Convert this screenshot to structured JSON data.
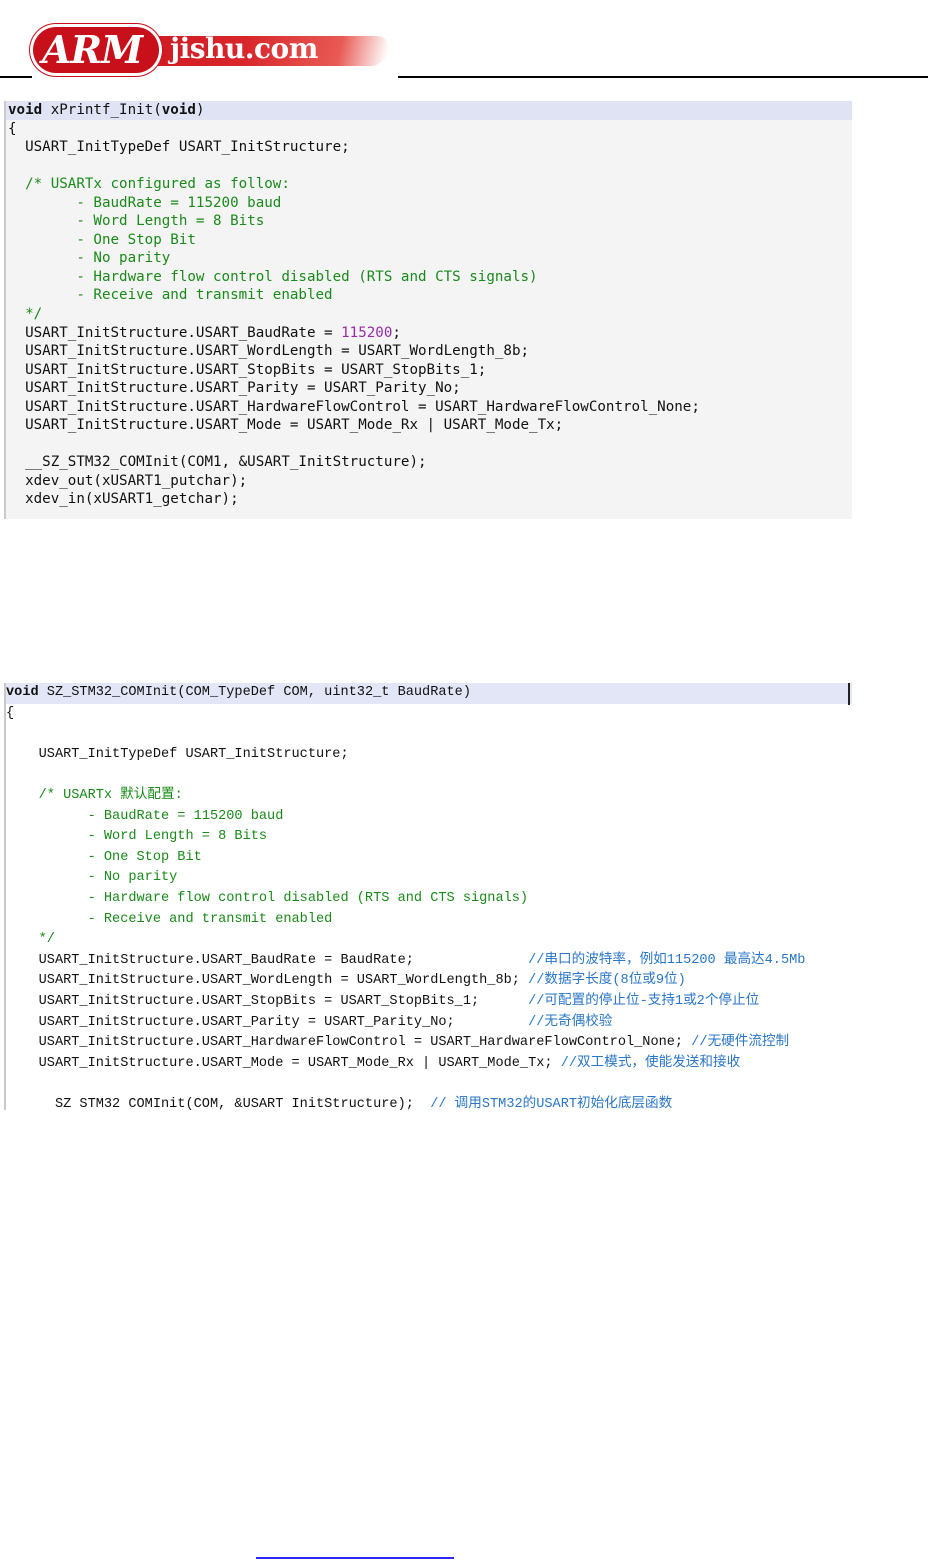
{
  "header": {
    "logo_brand": "ARM",
    "logo_site": "jishu.com"
  },
  "colors": {
    "code_keyword": "#111111",
    "code_comment": "#1a8a1a",
    "code_number": "#9a2aa8",
    "code_chinese_comment": "#2a76c8",
    "panel1_background": "#f4f4f4",
    "panel1_header_highlight": "#dfe3f3",
    "panel2_header_highlight": "#e3e6f6",
    "logo_red": "#c8101a"
  },
  "code_block_1": {
    "lines": [
      [
        {
          "t": "void",
          "c": "kw"
        },
        {
          "t": " xPrintf_Init("
        },
        {
          "t": "void",
          "c": "kw"
        },
        {
          "t": ")"
        }
      ],
      [
        {
          "t": "{"
        }
      ],
      [
        {
          "t": "  USART_InitTypeDef USART_InitStructure;"
        }
      ],
      [
        {
          "t": ""
        }
      ],
      [
        {
          "t": "  /* USARTx configured as follow:",
          "c": "cm"
        }
      ],
      [
        {
          "t": "        - BaudRate = 115200 baud",
          "c": "cm"
        }
      ],
      [
        {
          "t": "        - Word Length = 8 Bits",
          "c": "cm"
        }
      ],
      [
        {
          "t": "        - One Stop Bit",
          "c": "cm"
        }
      ],
      [
        {
          "t": "        - No parity",
          "c": "cm"
        }
      ],
      [
        {
          "t": "        - Hardware flow control disabled (RTS and CTS signals)",
          "c": "cm"
        }
      ],
      [
        {
          "t": "        - Receive and transmit enabled",
          "c": "cm"
        }
      ],
      [
        {
          "t": "  */",
          "c": "cm"
        }
      ],
      [
        {
          "t": "  USART_InitStructure.USART_BaudRate = "
        },
        {
          "t": "115200",
          "c": "num"
        },
        {
          "t": ";"
        }
      ],
      [
        {
          "t": "  USART_InitStructure.USART_WordLength = USART_WordLength_8b;"
        }
      ],
      [
        {
          "t": "  USART_InitStructure.USART_StopBits = USART_StopBits_1;"
        }
      ],
      [
        {
          "t": "  USART_InitStructure.USART_Parity = USART_Parity_No;"
        }
      ],
      [
        {
          "t": "  USART_InitStructure.USART_HardwareFlowControl = USART_HardwareFlowControl_None;"
        }
      ],
      [
        {
          "t": "  USART_InitStructure.USART_Mode = USART_Mode_Rx | USART_Mode_Tx;"
        }
      ],
      [
        {
          "t": ""
        }
      ],
      [
        {
          "t": "  __SZ_STM32_COMInit(COM1, &USART_InitStructure);"
        }
      ],
      [
        {
          "t": "  xdev_out(xUSART1_putchar);"
        }
      ],
      [
        {
          "t": "  xdev_in(xUSART1_getchar);"
        }
      ]
    ]
  },
  "code_block_2": {
    "lines": [
      [
        {
          "t": "void",
          "c": "kw"
        },
        {
          "t": " SZ_STM32_COMInit(COM_TypeDef COM, uint32_t BaudRate)"
        }
      ],
      [
        {
          "t": "{"
        }
      ],
      [
        {
          "t": ""
        }
      ],
      [
        {
          "t": "    USART_InitTypeDef USART_InitStructure;"
        }
      ],
      [
        {
          "t": ""
        }
      ],
      [
        {
          "t": "    /* USARTx 默认配置:",
          "c": "cm"
        }
      ],
      [
        {
          "t": "          - BaudRate = 115200 baud",
          "c": "cm"
        }
      ],
      [
        {
          "t": "          - Word Length = 8 Bits",
          "c": "cm"
        }
      ],
      [
        {
          "t": "          - One Stop Bit",
          "c": "cm"
        }
      ],
      [
        {
          "t": "          - No parity",
          "c": "cm"
        }
      ],
      [
        {
          "t": "          - Hardware flow control disabled (RTS and CTS signals)",
          "c": "cm"
        }
      ],
      [
        {
          "t": "          - Receive and transmit enabled",
          "c": "cm"
        }
      ],
      [
        {
          "t": "    */",
          "c": "cm"
        }
      ],
      [
        {
          "t": "    USART_InitStructure.USART_BaudRate = BaudRate;              "
        },
        {
          "t": "//串口的波特率，例如115200 最高达4.5Mb",
          "c": "cn"
        }
      ],
      [
        {
          "t": "    USART_InitStructure.USART_WordLength = USART_WordLength_8b; "
        },
        {
          "t": "//数据字长度(8位或9位)",
          "c": "cn"
        }
      ],
      [
        {
          "t": "    USART_InitStructure.USART_StopBits = USART_StopBits_1;      "
        },
        {
          "t": "//可配置的停止位-支持1或2个停止位",
          "c": "cn"
        }
      ],
      [
        {
          "t": "    USART_InitStructure.USART_Parity = USART_Parity_No;         "
        },
        {
          "t": "//无奇偶校验",
          "c": "cn"
        }
      ],
      [
        {
          "t": "    USART_InitStructure.USART_HardwareFlowControl = USART_HardwareFlowControl_None; "
        },
        {
          "t": "//无硬件流控制",
          "c": "cn"
        }
      ],
      [
        {
          "t": "    USART_InitStructure.USART_Mode = USART_Mode_Rx | USART_Mode_Tx; "
        },
        {
          "t": "//双工模式，使能发送和接收",
          "c": "cn"
        }
      ],
      [
        {
          "t": ""
        }
      ],
      [
        {
          "t": "      SZ STM32 COMInit(COM, &USART InitStructure);  "
        },
        {
          "t": "// 调用STM32的USART初始化底层函数",
          "c": "cn"
        }
      ]
    ]
  }
}
